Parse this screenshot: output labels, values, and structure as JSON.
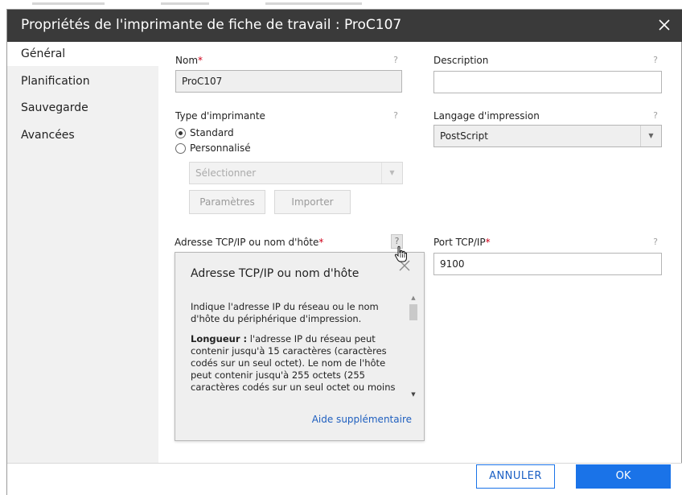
{
  "dialog": {
    "title": "Propriétés de l'imprimante de fiche de travail : ProC107",
    "close_icon": "close-icon"
  },
  "sidebar": {
    "items": [
      {
        "label": "Général",
        "active": true
      },
      {
        "label": "Planification",
        "active": false
      },
      {
        "label": "Sauvegarde",
        "active": false
      },
      {
        "label": "Avancées",
        "active": false
      }
    ]
  },
  "form": {
    "name": {
      "label": "Nom",
      "required_mark": "*",
      "value": "ProC107",
      "help": "?"
    },
    "description": {
      "label": "Description",
      "value": "",
      "help": "?"
    },
    "printer_type": {
      "label": "Type d'imprimante",
      "help": "?",
      "options": [
        {
          "label": "Standard",
          "checked": true
        },
        {
          "label": "Personnalisé",
          "checked": false
        }
      ],
      "select_placeholder": "Sélectionner",
      "params_button": "Paramètres",
      "import_button": "Importer"
    },
    "print_language": {
      "label": "Langage d'impression",
      "value": "PostScript",
      "help": "?"
    },
    "host": {
      "label": "Adresse TCP/IP ou nom d'hôte",
      "required_mark": "*",
      "help": "?"
    },
    "port": {
      "label": "Port TCP/IP",
      "required_mark": "*",
      "value": "9100",
      "help": "?"
    }
  },
  "popover": {
    "title": "Adresse TCP/IP ou nom d'hôte",
    "paragraph1": "Indique l'adresse IP du réseau ou le nom d'hôte du périphérique d'impression.",
    "paragraph2_bold": "Longueur :",
    "paragraph2": " l'adresse IP du réseau peut contenir jusqu'à 15 caractères (caractères codés sur un seul octet). Le nom de l'hôte peut contenir jusqu'à 255 octets (255 caractères codés sur un seul octet ou moins",
    "link": "Aide supplémentaire"
  },
  "footer": {
    "cancel": "ANNULER",
    "ok": "OK"
  },
  "colors": {
    "titlebar": "#3a3a3a",
    "accent": "#1a73e8",
    "required": "#d0021b",
    "sidebar_bg": "#f1f1f1"
  }
}
